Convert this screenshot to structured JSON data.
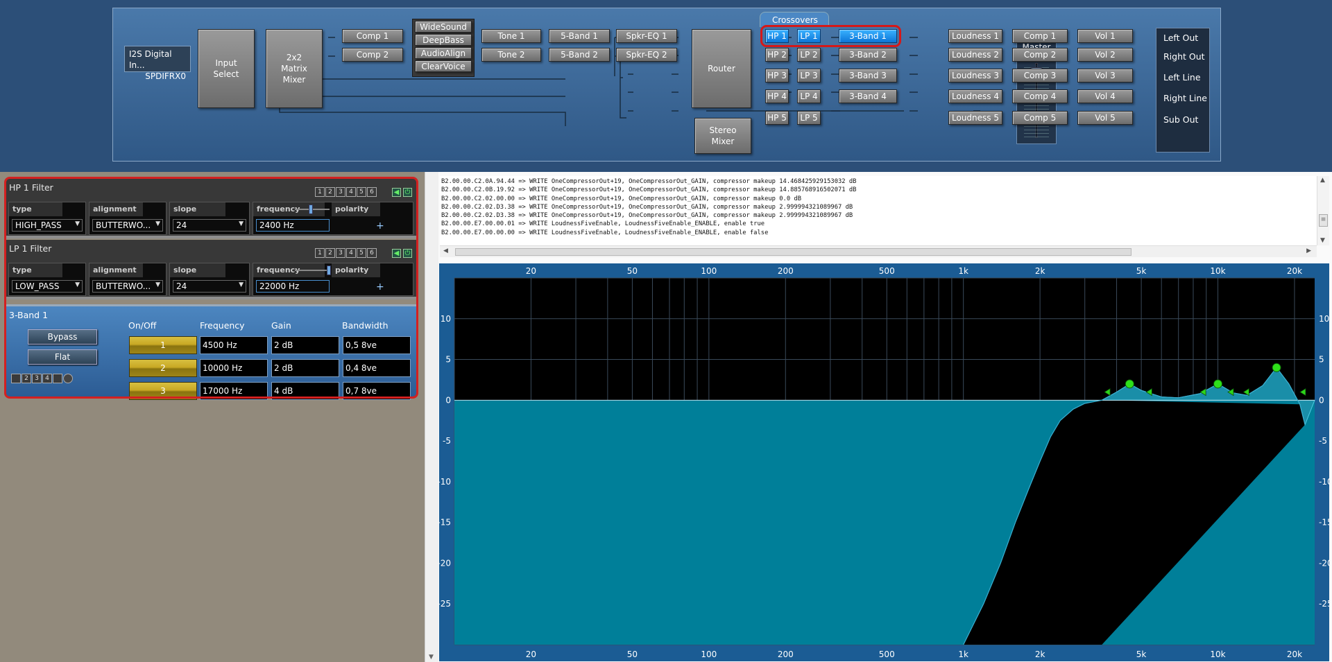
{
  "signal_flow": {
    "input": {
      "line1": "I2S Digital In...",
      "line2": "SPDIFRX0"
    },
    "input_select": "Input\nSelect",
    "mixer": "2x2\nMatrix\nMixer",
    "comp_top": [
      "Comp 1",
      "Comp 2"
    ],
    "enhancers": [
      "WideSound",
      "DeepBass",
      "AudioAlign",
      "ClearVoice"
    ],
    "tone": [
      "Tone 1",
      "Tone 2"
    ],
    "band5": [
      "5-Band 1",
      "5-Band 2"
    ],
    "spkr_eq": [
      "Spkr-EQ 1",
      "Spkr-EQ 2"
    ],
    "router": "Router",
    "stereo_mixer": "Stereo\nMixer",
    "crossovers_label": "Crossovers",
    "hp": [
      "HP 1",
      "HP 2",
      "HP 3",
      "HP 4",
      "HP 5"
    ],
    "lp": [
      "LP 1",
      "LP 2",
      "LP 3",
      "LP 4",
      "LP 5"
    ],
    "band3": [
      "3-Band 1",
      "3-Band 2",
      "3-Band 3",
      "3-Band 4"
    ],
    "master_volume": "Master\nVolume",
    "loudness": [
      "Loudness 1",
      "Loudness 2",
      "Loudness 3",
      "Loudness 4",
      "Loudness 5"
    ],
    "comp_out": [
      "Comp 1",
      "Comp 2",
      "Comp 3",
      "Comp 4",
      "Comp 5"
    ],
    "vol": [
      "Vol 1",
      "Vol 2",
      "Vol 3",
      "Vol 4",
      "Vol 5"
    ],
    "outputs": [
      "Left Out",
      "Right Out",
      "Left Line",
      "Right Line",
      "Sub Out"
    ]
  },
  "hp_filter": {
    "title": "HP 1 Filter",
    "pages": [
      "1",
      "2",
      "3",
      "4",
      "5",
      "6"
    ],
    "type_label": "type",
    "type_value": "HIGH_PASS",
    "alignment_label": "alignment",
    "alignment_value": "BUTTERWO...",
    "slope_label": "slope",
    "slope_value": "24",
    "frequency_label": "frequency",
    "frequency_value": "2400 Hz",
    "polarity_label": "polarity",
    "polarity_value": "+"
  },
  "lp_filter": {
    "title": "LP 1 Filter",
    "pages": [
      "1",
      "2",
      "3",
      "4",
      "5",
      "6"
    ],
    "type_label": "type",
    "type_value": "LOW_PASS",
    "alignment_label": "alignment",
    "alignment_value": "BUTTERWO...",
    "slope_label": "slope",
    "slope_value": "24",
    "frequency_label": "frequency",
    "frequency_value": "22000 Hz",
    "polarity_label": "polarity",
    "polarity_value": "+"
  },
  "band3_panel": {
    "title": "3-Band 1",
    "bypass_label": "Bypass",
    "flat_label": "Flat",
    "pages": [
      "1",
      "2",
      "3",
      "4"
    ],
    "col_onoff": "On/Off",
    "col_frequency": "Frequency",
    "col_gain": "Gain",
    "col_bandwidth": "Bandwidth",
    "bands": [
      {
        "num": "1",
        "frequency": "4500 Hz",
        "gain": "2 dB",
        "bandwidth": "0,5 8ve"
      },
      {
        "num": "2",
        "frequency": "10000 Hz",
        "gain": "2 dB",
        "bandwidth": "0,4 8ve"
      },
      {
        "num": "3",
        "frequency": "17000 Hz",
        "gain": "4 dB",
        "bandwidth": "0,7 8ve"
      }
    ]
  },
  "log_lines": [
    "B2.00.00.C2.0A.94.44 => WRITE OneCompressorOut+19, OneCompressorOut_GAIN, compressor makeup 14.468425929153032 dB",
    "B2.00.00.C2.0B.19.92 => WRITE OneCompressorOut+19, OneCompressorOut_GAIN, compressor makeup 14.885768916502071 dB",
    "B2.00.00.C2.02.00.00 => WRITE OneCompressorOut+19, OneCompressorOut_GAIN, compressor makeup 0.0 dB",
    "B2.00.00.C2.02.D3.38 => WRITE OneCompressorOut+19, OneCompressorOut_GAIN, compressor makeup 2.999994321089967 dB",
    "B2.00.00.C2.02.D3.38 => WRITE OneCompressorOut+19, OneCompressorOut_GAIN, compressor makeup 2.999994321089967 dB",
    "B2.00.00.E7.00.00.01 => WRITE LoudnessFiveEnable, LoudnessFiveEnable_ENABLE, enable true",
    "B2.00.00.E7.00.00.00 => WRITE LoudnessFiveEnable, LoudnessFiveEnable_ENABLE, enable false"
  ],
  "chart_data": {
    "type": "area",
    "x_scale": "log",
    "xlim": [
      10,
      24000
    ],
    "ylim": [
      -30,
      15
    ],
    "grid": true,
    "x_tick_labels": [
      {
        "v": 20,
        "label": "20"
      },
      {
        "v": 50,
        "label": "50"
      },
      {
        "v": 100,
        "label": "100"
      },
      {
        "v": 200,
        "label": "200"
      },
      {
        "v": 500,
        "label": "500"
      },
      {
        "v": 1000,
        "label": "1k"
      },
      {
        "v": 2000,
        "label": "2k"
      },
      {
        "v": 5000,
        "label": "5k"
      },
      {
        "v": 10000,
        "label": "10k"
      },
      {
        "v": 20000,
        "label": "20k"
      }
    ],
    "y_ticks": [
      10,
      5,
      0,
      -5,
      -10,
      -15,
      -20,
      -25
    ],
    "response_curve": [
      [
        1000,
        -31
      ],
      [
        1200,
        -25
      ],
      [
        1400,
        -20
      ],
      [
        1600,
        -15
      ],
      [
        1800,
        -11
      ],
      [
        2000,
        -7.5
      ],
      [
        2200,
        -4.5
      ],
      [
        2400,
        -2.5
      ],
      [
        2700,
        -1.1
      ],
      [
        3000,
        -0.4
      ],
      [
        3500,
        0
      ],
      [
        4000,
        1
      ],
      [
        4500,
        2
      ],
      [
        5000,
        1.2
      ],
      [
        6000,
        0.4
      ],
      [
        7000,
        0.3
      ],
      [
        8500,
        0.8
      ],
      [
        10000,
        2
      ],
      [
        11500,
        0.9
      ],
      [
        13000,
        0.6
      ],
      [
        15000,
        1.8
      ],
      [
        17000,
        4
      ],
      [
        19000,
        2
      ],
      [
        21000,
        -0.5
      ],
      [
        22000,
        -3
      ]
    ],
    "eq_points": [
      {
        "freq": 4500,
        "gain": 2
      },
      {
        "freq": 10000,
        "gain": 2
      },
      {
        "freq": 17000,
        "gain": 4
      }
    ],
    "bw_handles": [
      {
        "freq": 3700,
        "gain": 1
      },
      {
        "freq": 5400,
        "gain": 1
      },
      {
        "freq": 8800,
        "gain": 1
      },
      {
        "freq": 11300,
        "gain": 1
      },
      {
        "freq": 13000,
        "gain": 1
      },
      {
        "freq": 21700,
        "gain": 1
      }
    ],
    "colors": {
      "fill": "#007f99",
      "grid": "#3a4a5a",
      "zero": "#b8e0ec",
      "point": "#2ee01a",
      "curve": "#1a8ea8"
    }
  },
  "colors": {
    "accent": "#1a8ef0",
    "highlight": "#d61818"
  }
}
